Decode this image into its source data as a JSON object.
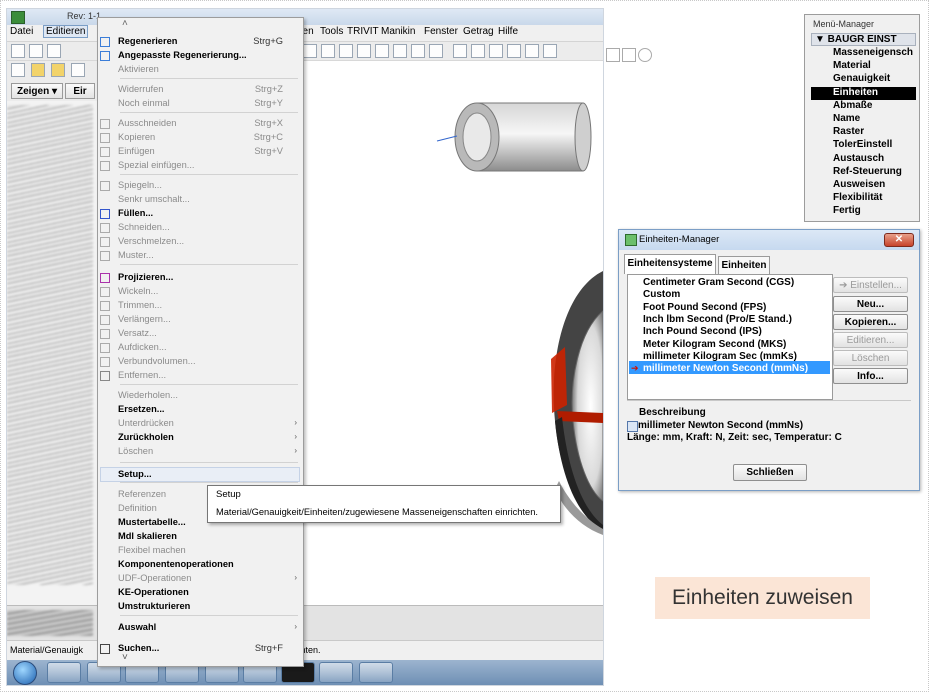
{
  "window": {
    "title_fragment": "Rev: 1-1"
  },
  "menubar": {
    "items": [
      "Datei",
      "Editieren",
      "hen",
      "Tools",
      "TRIVIT",
      "Manikin",
      "Fenster",
      "Getrag",
      "Hilfe"
    ]
  },
  "toolbar_buttons": {
    "zeigen": "Zeigen ▾",
    "eir": "Eir"
  },
  "dropdown": {
    "scroll_up": "˄",
    "items": [
      {
        "label": "Regenerieren",
        "shortcut": "Strg+G",
        "enabled": true
      },
      {
        "label": "Angepasste Regenerierung...",
        "shortcut": "",
        "enabled": true
      },
      {
        "label": "Aktivieren",
        "shortcut": "",
        "enabled": false
      },
      {
        "label": "Widerrufen",
        "shortcut": "Strg+Z",
        "enabled": false
      },
      {
        "label": "Noch einmal",
        "shortcut": "Strg+Y",
        "enabled": false
      },
      {
        "label": "Ausschneiden",
        "shortcut": "Strg+X",
        "enabled": false
      },
      {
        "label": "Kopieren",
        "shortcut": "Strg+C",
        "enabled": false
      },
      {
        "label": "Einfügen",
        "shortcut": "Strg+V",
        "enabled": false
      },
      {
        "label": "Spezial einfügen...",
        "shortcut": "",
        "enabled": false
      },
      {
        "label": "Spiegeln...",
        "shortcut": "",
        "enabled": false
      },
      {
        "label": "Senkr umschalt...",
        "shortcut": "",
        "enabled": false
      },
      {
        "label": "Füllen...",
        "shortcut": "",
        "enabled": true
      },
      {
        "label": "Schneiden...",
        "shortcut": "",
        "enabled": false
      },
      {
        "label": "Verschmelzen...",
        "shortcut": "",
        "enabled": false
      },
      {
        "label": "Muster...",
        "shortcut": "",
        "enabled": false
      },
      {
        "label": "Projizieren...",
        "shortcut": "",
        "enabled": true
      },
      {
        "label": "Wickeln...",
        "shortcut": "",
        "enabled": false
      },
      {
        "label": "Trimmen...",
        "shortcut": "",
        "enabled": false
      },
      {
        "label": "Verlängern...",
        "shortcut": "",
        "enabled": false
      },
      {
        "label": "Versatz...",
        "shortcut": "",
        "enabled": false
      },
      {
        "label": "Aufdicken...",
        "shortcut": "",
        "enabled": false
      },
      {
        "label": "Verbundvolumen...",
        "shortcut": "",
        "enabled": false
      },
      {
        "label": "Entfernen...",
        "shortcut": "",
        "enabled": false
      },
      {
        "label": "Wiederholen...",
        "shortcut": "",
        "enabled": false
      },
      {
        "label": "Ersetzen...",
        "shortcut": "",
        "enabled": true
      },
      {
        "label": "Unterdrücken",
        "shortcut": "",
        "enabled": false
      },
      {
        "label": "Zurückholen",
        "shortcut": "",
        "enabled": true
      },
      {
        "label": "Löschen",
        "shortcut": "",
        "enabled": false
      },
      {
        "label": "Setup...",
        "shortcut": "",
        "enabled": true
      },
      {
        "label": "Referenzen",
        "shortcut": "",
        "enabled": false
      },
      {
        "label": "Definition",
        "shortcut": "",
        "enabled": false
      },
      {
        "label": "Mustertabelle...",
        "shortcut": "",
        "enabled": true
      },
      {
        "label": "Mdl skalieren",
        "shortcut": "",
        "enabled": true
      },
      {
        "label": "Flexibel machen",
        "shortcut": "",
        "enabled": false
      },
      {
        "label": "Komponentenoperationen",
        "shortcut": "",
        "enabled": true
      },
      {
        "label": "UDF-Operationen",
        "shortcut": "",
        "enabled": false
      },
      {
        "label": "KE-Operationen",
        "shortcut": "",
        "enabled": true
      },
      {
        "label": "Umstrukturieren",
        "shortcut": "",
        "enabled": true
      },
      {
        "label": "Auswahl",
        "shortcut": "",
        "enabled": true
      },
      {
        "label": "Suchen...",
        "shortcut": "Strg+F",
        "enabled": true
      }
    ]
  },
  "tooltip": {
    "title": "Setup",
    "text": "Material/Genauigkeit/Einheiten/zugewiesene Masseneigenschaften einrichten."
  },
  "statusbar": {
    "left": "Material/Genauigk",
    "right": "einrichten.",
    "msg_fragment": "t."
  },
  "menu_manager": {
    "header": "Menü-Manager",
    "title": "▼ BAUGR EINST",
    "items": [
      "Masseneigensch",
      "Material",
      "Genauigkeit",
      "Einheiten",
      "Abmaße",
      "Name",
      "Raster",
      "TolerEinstell",
      "Austausch",
      "Ref-Steuerung",
      "Ausweisen",
      "Flexibilität",
      "Fertig"
    ],
    "selected": "Einheiten"
  },
  "units_manager": {
    "title": "Einheiten-Manager",
    "tabs": [
      "Einheitensysteme",
      "Einheiten"
    ],
    "systems": [
      "Centimeter Gram Second (CGS)",
      "Custom",
      "Foot Pound Second (FPS)",
      "Inch lbm Second (Pro/E Stand.)",
      "Inch Pound Second (IPS)",
      "Meter Kilogram Second (MKS)",
      "millimeter Kilogram Sec (mmKs)",
      "millimeter Newton Second (mmNs)"
    ],
    "selected": "millimeter Newton Second (mmNs)",
    "buttons": [
      "➔ Einstellen...",
      "Neu...",
      "Kopieren...",
      "Editieren...",
      "Löschen",
      "Info..."
    ],
    "description_label": "Beschreibung",
    "description_title": "millimeter Newton Second (mmNs)",
    "description_text": "Länge: mm, Kraft: N, Zeit: sec, Temperatur: C",
    "close_button": "Schließen"
  },
  "caption": "Einheiten zuweisen",
  "colors": {
    "menu_selection": "#000000",
    "list_selection": "#3399ff",
    "caption_bg": "#fbe5d6",
    "model_red": "#cc2200"
  }
}
